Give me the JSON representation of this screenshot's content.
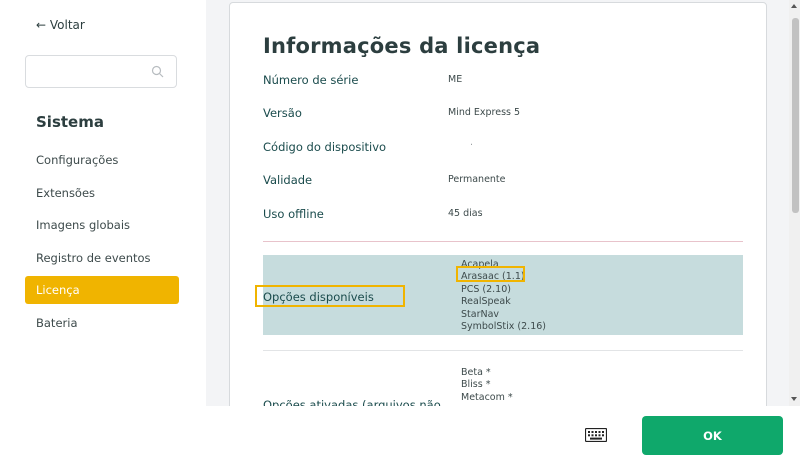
{
  "sidebar": {
    "back_label": "← Voltar",
    "search_placeholder": "",
    "section_title": "Sistema",
    "items": [
      {
        "label": "Configurações"
      },
      {
        "label": "Extensões"
      },
      {
        "label": "Imagens globais"
      },
      {
        "label": "Registro de eventos"
      },
      {
        "label": "Licença",
        "active": true
      },
      {
        "label": "Bateria"
      }
    ]
  },
  "card": {
    "title": "Informações da licença",
    "rows": [
      {
        "label": "Número de série",
        "value": "ME"
      },
      {
        "label": "Versão",
        "value": "Mind Express 5"
      },
      {
        "label": "Código do dispositivo",
        "value": "."
      },
      {
        "label": "Validade",
        "value": "Permanente"
      },
      {
        "label": "Uso offline",
        "value": "45 dias"
      }
    ],
    "options_label": "Opções disponíveis",
    "options": [
      "Acapela",
      "Arasaac (1.1)",
      "PCS (2.10)",
      "RealSpeak",
      "StarNav",
      "SymbolStix (2.16)"
    ],
    "activated_label": "Opções ativadas (arquivos não",
    "activated": [
      "Beta *",
      "Bliss *",
      "Metacom *"
    ]
  },
  "footer": {
    "ok_label": "OK",
    "keyboard_icon": "keyboard-icon"
  },
  "colors": {
    "accent": "#f0b400",
    "ok_button": "#0fa86b",
    "options_bg": "#c6dcdd",
    "label_text": "#1a4b4c"
  }
}
